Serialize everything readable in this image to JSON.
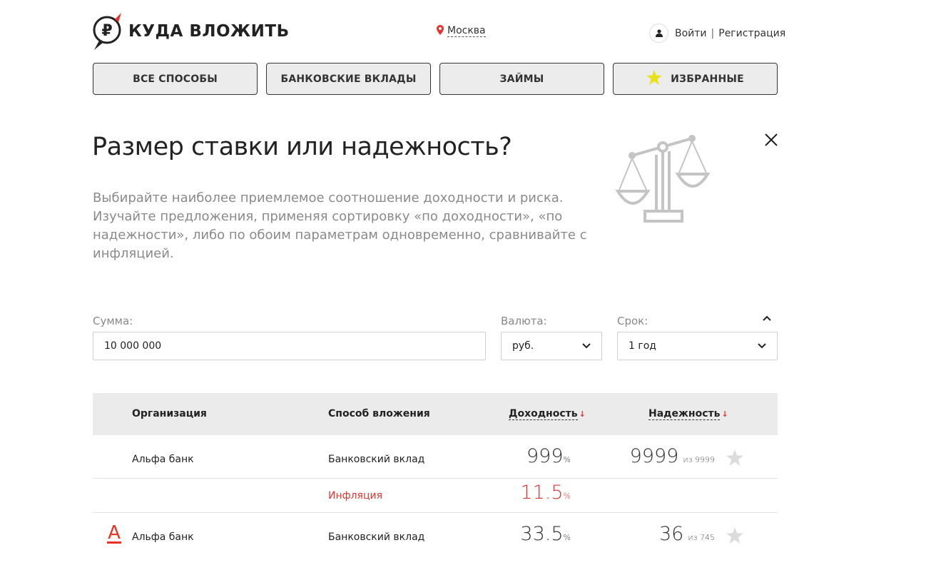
{
  "header": {
    "logo_text": "КУДА ВЛОЖИТЬ",
    "city": "Москва",
    "login": "Войти",
    "separator": "|",
    "register": "Регистрация"
  },
  "nav": {
    "items": [
      {
        "label": "ВСЕ СПОСОБЫ"
      },
      {
        "label": "БАНКОВСКИЕ ВКЛАДЫ"
      },
      {
        "label": "ЗАЙМЫ"
      },
      {
        "label": "ИЗБРАННЫЕ",
        "icon": "star-icon"
      }
    ]
  },
  "hint": {
    "title": "Размер ставки или надежность?",
    "text": "Выбирайте наиболее приемлемое соотношение доходности и риска. Изучайте предложения, применяя сортировку «по доходности», «по надежности», либо по обоим параметрам одновременно, сравнивайте с инфляцией."
  },
  "form": {
    "amount_label": "Сумма:",
    "amount_value": "10 000 000",
    "currency_label": "Валюта:",
    "currency_value": "руб.",
    "term_label": "Срок:",
    "term_value": "1 год"
  },
  "table": {
    "headers": {
      "organization": "Организация",
      "method": "Способ вложения",
      "yield": "Доходность",
      "reliability": "Надежность",
      "sort_arrow": "↓"
    },
    "rows": [
      {
        "org": "Альфа банк",
        "method": "Банковский вклад",
        "yield": "999",
        "yield_unit": "%",
        "rel": "9999",
        "rel_of": "из 9999"
      },
      {
        "method": "Инфляция",
        "yield": "11.5",
        "yield_unit": "%"
      },
      {
        "org": "Альфа банк",
        "method": "Банковский вклад",
        "yield": "33.5",
        "yield_unit": "%",
        "rel": "36",
        "rel_of": "из 745",
        "logo_letter": "А"
      }
    ]
  },
  "colors": {
    "accent_red": "#e3342f",
    "star_yellow": "#e8e21a",
    "nav_bg": "#ececec"
  }
}
